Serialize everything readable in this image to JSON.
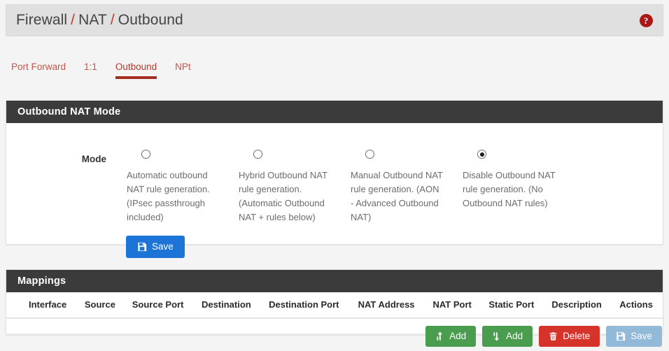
{
  "header": {
    "breadcrumb": [
      {
        "text": "Firewall",
        "type": "crumb"
      },
      {
        "text": "/",
        "type": "sep"
      },
      {
        "text": "NAT",
        "type": "crumb"
      },
      {
        "text": "/",
        "type": "sep"
      },
      {
        "text": "Outbound",
        "type": "crumb"
      }
    ],
    "help_icon": "help-question-icon",
    "help_glyph": "?"
  },
  "tabs": [
    {
      "label": "Port Forward",
      "active": false
    },
    {
      "label": "1:1",
      "active": false
    },
    {
      "label": "Outbound",
      "active": true
    },
    {
      "label": "NPt",
      "active": false
    }
  ],
  "nat_mode": {
    "panel_title": "Outbound NAT Mode",
    "field_label": "Mode",
    "options": [
      {
        "value": "automatic",
        "description": "Automatic outbound NAT rule generation. (IPsec passthrough included)",
        "selected": false
      },
      {
        "value": "hybrid",
        "description": "Hybrid Outbound NAT rule generation. (Automatic Outbound NAT + rules below)",
        "selected": false
      },
      {
        "value": "manual",
        "description": "Manual Outbound NAT rule generation. (AON - Advanced Outbound NAT)",
        "selected": false
      },
      {
        "value": "disabled",
        "description": "Disable Outbound NAT rule generation. (No Outbound NAT rules)",
        "selected": true
      }
    ],
    "save_label": "Save",
    "save_icon": "floppy-save-icon"
  },
  "mappings": {
    "panel_title": "Mappings",
    "columns": [
      "Interface",
      "Source",
      "Source Port",
      "Destination",
      "Destination Port",
      "NAT Address",
      "NAT Port",
      "Static Port",
      "Description",
      "Actions"
    ],
    "rows": []
  },
  "action_buttons": [
    {
      "label": "Add",
      "icon": "arrow-level-up-icon",
      "style": "success"
    },
    {
      "label": "Add",
      "icon": "arrow-level-down-icon",
      "style": "success"
    },
    {
      "label": "Delete",
      "icon": "trash-icon",
      "style": "danger"
    },
    {
      "label": "Save",
      "icon": "floppy-save-icon",
      "style": "muted"
    }
  ],
  "colors": {
    "accent_red": "#a82c22",
    "panel_header": "#3b3b3b",
    "primary_blue": "#1b74d6",
    "success_green": "#4a9c4e",
    "danger_red": "#d6342a",
    "muted_blue": "#93b9d8",
    "page_bg": "#f4f4f4",
    "header_bar_bg": "#e0e0e0"
  }
}
